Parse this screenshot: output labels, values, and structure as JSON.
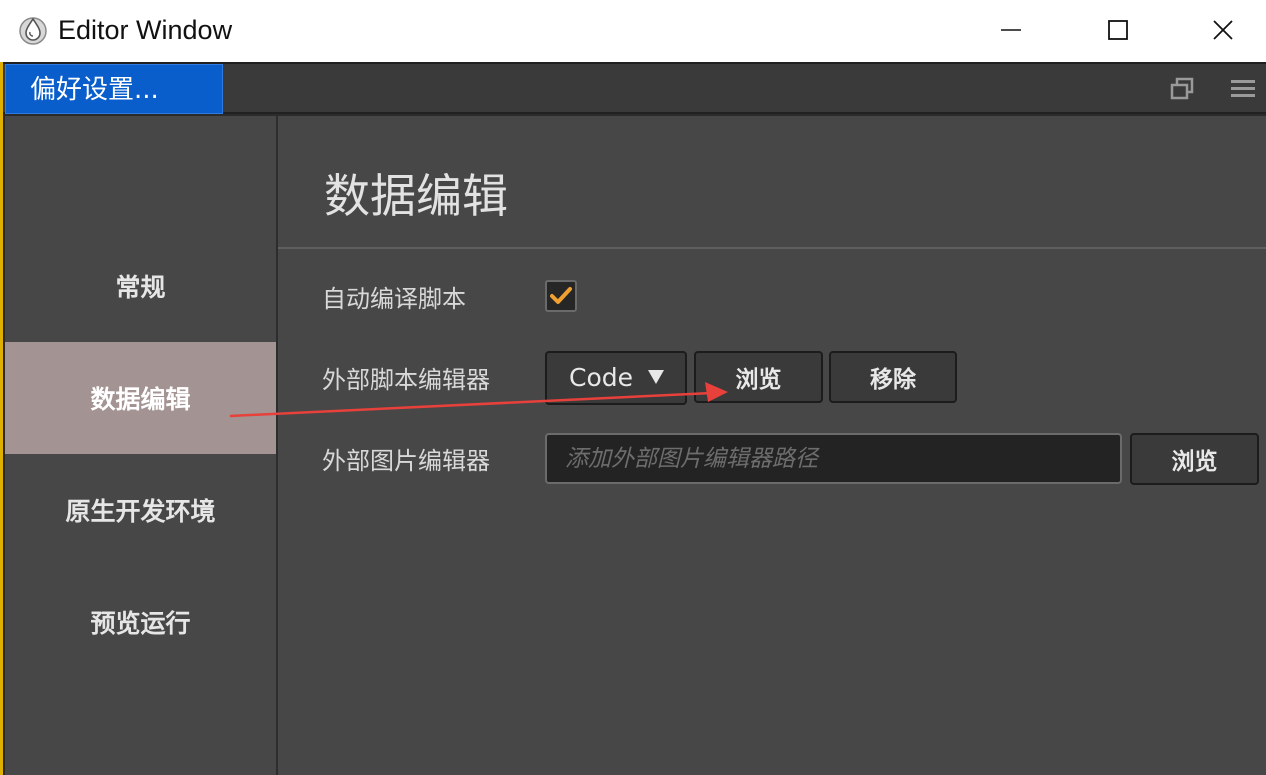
{
  "window": {
    "title": "Editor Window",
    "icon": "cocos-app-icon"
  },
  "tab": {
    "label": "偏好设置..."
  },
  "toolbar_icons": [
    "restore-window-icon",
    "hamburger-menu-icon"
  ],
  "sidebar": {
    "items": [
      {
        "label": "常规",
        "active": false
      },
      {
        "label": "数据编辑",
        "active": true
      },
      {
        "label": "原生开发环境",
        "active": false
      },
      {
        "label": "预览运行",
        "active": false
      }
    ]
  },
  "main": {
    "title": "数据编辑",
    "auto_compile": {
      "label": "自动编译脚本",
      "checked": true
    },
    "script_editor": {
      "label": "外部脚本编辑器",
      "selected": "Code",
      "browse_label": "浏览",
      "remove_label": "移除"
    },
    "image_editor": {
      "label": "外部图片编辑器",
      "value": "",
      "placeholder": "添加外部图片编辑器路径",
      "browse_label": "浏览"
    }
  },
  "colors": {
    "accent_blue": "#0a5ecb",
    "active_sidebar": "#a39393",
    "checkbox_orange": "#f0a030",
    "annotation_red": "#e8403a"
  }
}
